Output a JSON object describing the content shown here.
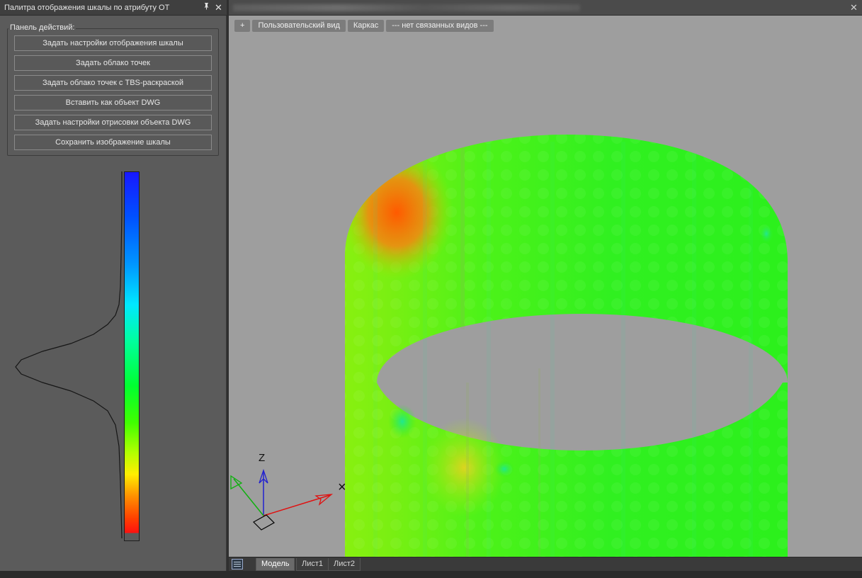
{
  "palette": {
    "title": "Палитра отображения шкалы по атрибуту ОТ",
    "pin_icon": "pin-icon",
    "close_glyph": "✕",
    "panel_label": "Панель действий:",
    "buttons": [
      "Задать настройки отображения шкалы",
      "Задать облако точек",
      "Задать облако точек с TBS-раскраской",
      "Вставить как объект DWG",
      "Задать настройки отрисовки объекта DWG",
      "Сохранить изображение шкалы"
    ],
    "scale_colors": [
      "#1818ff",
      "#00e8ff",
      "#00ff30",
      "#ffee00",
      "#ff1010"
    ]
  },
  "viewport": {
    "close_glyph": "✕",
    "toolbar": [
      "+",
      "Пользовательский вид",
      "Каркас",
      "--- нет связанных видов ---"
    ],
    "ucs": {
      "z_label": "Z",
      "x_marker": "×"
    }
  },
  "layout_tabs": [
    "Модель",
    "Лист1",
    "Лист2"
  ],
  "active_tab": "Модель"
}
